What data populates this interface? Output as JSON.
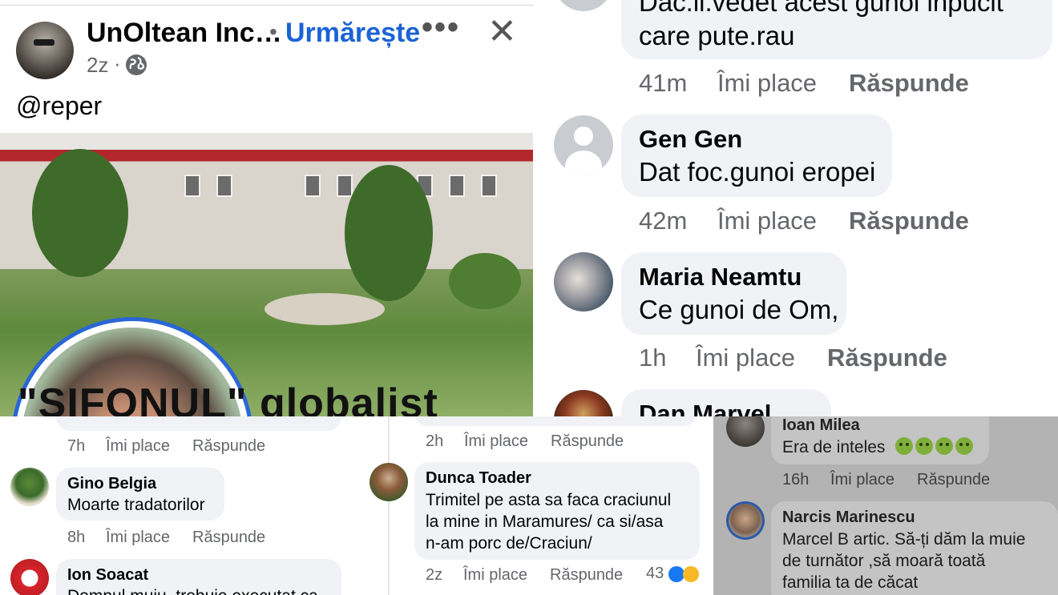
{
  "post": {
    "page_name": "UnOltean Inc…",
    "separator": "•",
    "follow_label": "Urmărește",
    "more_icon": "more-icon",
    "close_icon": "close-icon",
    "time": "2z",
    "mid_dot": "·",
    "privacy_icon": "globe-icon",
    "text": "@reper",
    "image_headline": "\"SIFONUL\" globalist"
  },
  "top_comments": {
    "partial_comment": {
      "text_line1": "Dac.il.vedet acest gunoi inpucit",
      "text_line2": "care pute.rau",
      "time": "41m"
    },
    "comments": [
      {
        "author": "Gen Gen",
        "text": "Dat foc.gunoi eropei",
        "time": "42m"
      },
      {
        "author": "Maria Neamtu",
        "text": "Ce gunoi de Om,",
        "time": "1h"
      },
      {
        "author": "Dan Marvel"
      }
    ],
    "like_label": "Îmi place",
    "reply_label": "Răspunde"
  },
  "bottom_left": {
    "first_time": "7h",
    "comments": [
      {
        "author": "Gino Belgia",
        "text": "Moarte tradatorilor",
        "time": "8h"
      },
      {
        "author": "Ion Soacat",
        "text": "Domnul muiu. trebuie executat ca"
      }
    ],
    "like_label": "Îmi place",
    "reply_label": "Răspunde"
  },
  "bottom_middle": {
    "first_time": "2h",
    "comment": {
      "author": "Dunca Toader",
      "lines": [
        "Trimitel pe asta sa faca craciunul",
        "la mine in Maramures/ ca si/asa",
        "n-am porc de/Craciun/"
      ],
      "time": "2z",
      "reaction_count": "43"
    },
    "like_label": "Îmi place",
    "reply_label": "Răspunde",
    "colors": {
      "like_blue": "#1877f2",
      "haha_yellow": "#f7b928"
    }
  },
  "bottom_right": {
    "comments": [
      {
        "author": "Ioan Milea",
        "text": "Era de inteles",
        "time": "16h"
      },
      {
        "author": "Narcis Marinescu",
        "lines": [
          "Marcel B artic. Să-ți dăm la muie",
          "de turnător ,să moară toată",
          "familia ta de căcat"
        ]
      }
    ],
    "like_label": "Îmi place",
    "reply_label": "Răspunde",
    "emoji_icon": "nauseated-face-icon"
  },
  "colors": {
    "facebook_blue": "#1b63d4",
    "bubble_grey": "#f0f2f5",
    "meta_grey": "#65676b"
  }
}
